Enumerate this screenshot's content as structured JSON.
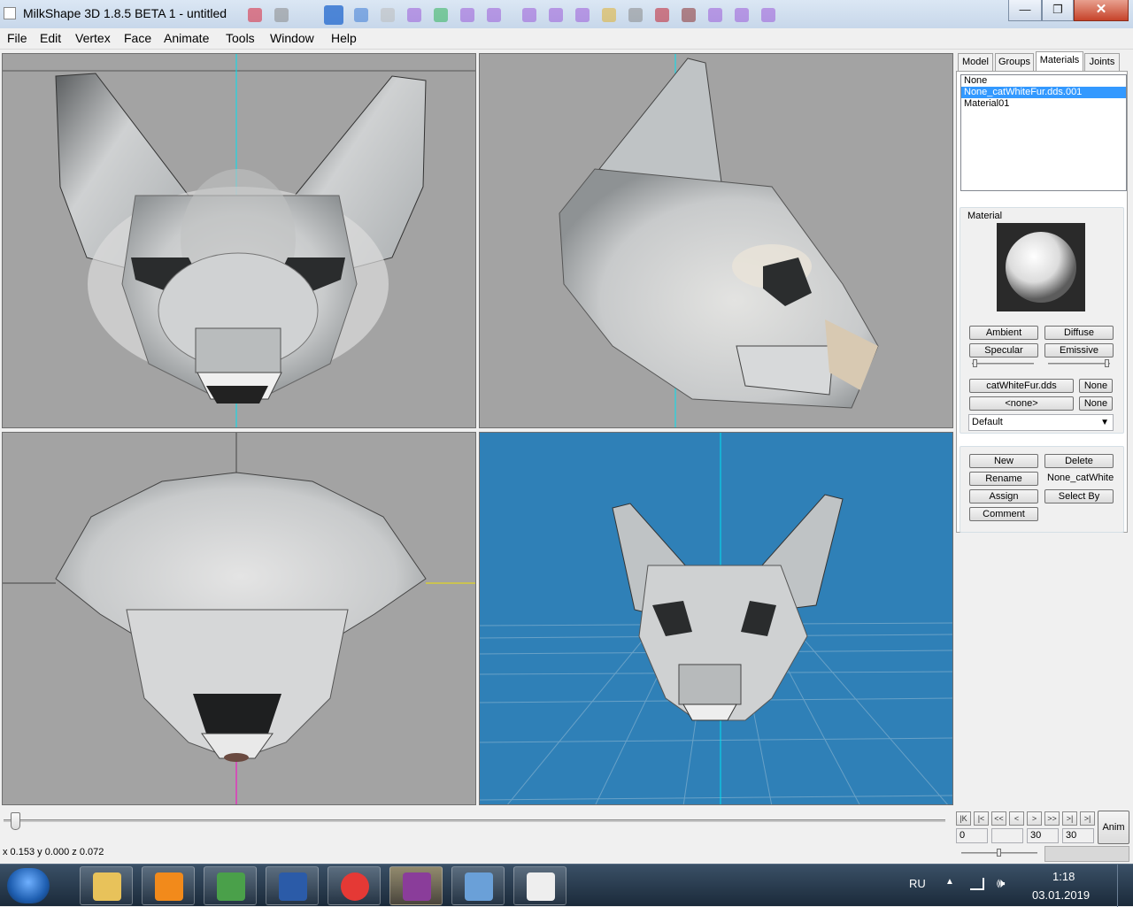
{
  "window": {
    "title": "MilkShape 3D 1.8.5 BETA 1 - untitled",
    "minimize_glyph": "—",
    "restore_glyph": "❐",
    "close_glyph": "✕"
  },
  "menu": [
    "File",
    "Edit",
    "Vertex",
    "Face",
    "Animate",
    "Tools",
    "Window",
    "Help"
  ],
  "panel": {
    "tabs": [
      "Model",
      "Groups",
      "Materials",
      "Joints"
    ],
    "active_tab": "Materials",
    "materials": [
      "None",
      "None_catWhiteFur.dds.001",
      "Material01"
    ],
    "selected_material": "None_catWhiteFur.dds.001",
    "material_group_label": "Material",
    "buttons": {
      "ambient": "Ambient",
      "diffuse": "Diffuse",
      "specular": "Specular",
      "emissive": "Emissive",
      "texture1": "catWhiteFur.dds",
      "texture1_none": "None",
      "texture2": "<none>",
      "texture2_none": "None",
      "mode": "Default",
      "new": "New",
      "delete": "Delete",
      "rename": "Rename",
      "name_value": "None_catWhite",
      "assign": "Assign",
      "select_by": "Select By",
      "comment": "Comment"
    }
  },
  "timeline": {
    "controls": [
      "|<",
      "<<",
      "<",
      ">",
      ">>",
      ">|"
    ],
    "left_glyph": "|K",
    "right_glyph": ">|",
    "frame_start": "0",
    "frame_current": "30",
    "frame_end": "30",
    "anim_label": "Anim"
  },
  "status": {
    "coords": "x 0.153 y 0.000 z 0.072"
  },
  "taskbar": {
    "lang": "RU",
    "time": "1:18",
    "date": "03.01.2019"
  },
  "colors": {
    "viewport_gray": "#a3a3a3",
    "perspective_blue": "#2f80b7",
    "axis_cyan": "#00e0f0",
    "axis_yellow": "#f0e000",
    "axis_magenta": "#ff00c8",
    "selection": "#3399ff"
  }
}
